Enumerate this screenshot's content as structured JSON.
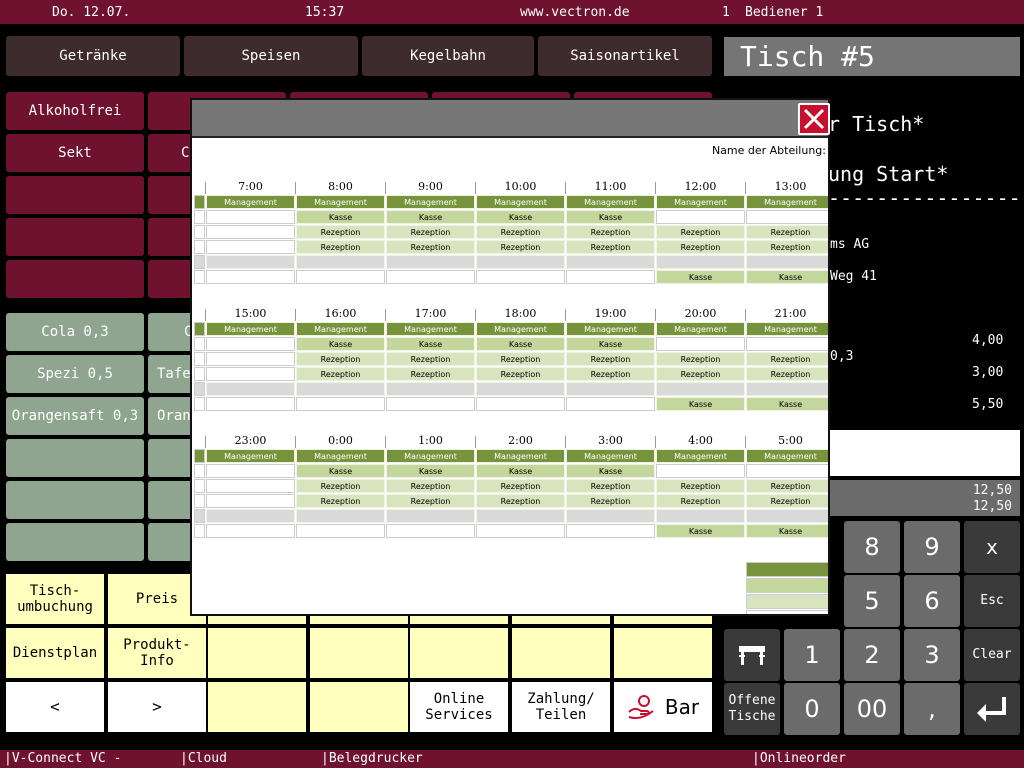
{
  "status_bar": {
    "date": "Do. 12.07.",
    "time": "15:37",
    "website": "www.vectron.de",
    "operator_no": "1",
    "operator_name": "Bediener 1"
  },
  "categories": [
    "Getränke",
    "Speisen",
    "Kegelbahn",
    "Saisonartikel"
  ],
  "subgroups": [
    "Alkoholfrei",
    "Sekt",
    "C"
  ],
  "products": [
    "Cola 0,3",
    "C",
    "Spezi 0,5",
    "Tafe",
    "Orangensaft 0,3",
    "Oran"
  ],
  "functions": {
    "tischumbuchung": "Tisch-\numbuchung",
    "preis": "Preis",
    "dienstplan": "Dienstplan",
    "produkt_info": "Produkt-\nInfo",
    "prev": "<",
    "next": ">",
    "online_services": "Online\nServices",
    "zahlung": "Zahlung/\nTeilen",
    "bar": "Bar"
  },
  "receipt": {
    "table_title": "Tisch #5",
    "line1": "r Tisch*",
    "line2": "ung Start*",
    "separator": "-------------------",
    "line3": "ms AG",
    "line4": "Weg 41",
    "amounts": [
      "4,00",
      "3,00",
      "5,50"
    ],
    "item_frag": "0,3",
    "total1": "12,50",
    "total2": "12,50"
  },
  "keypad": {
    "k8": "8",
    "k9": "9",
    "kx": "x",
    "k5": "5",
    "k6": "6",
    "esc": "Esc",
    "k1": "1",
    "k2": "2",
    "k3": "3",
    "clear": "Clear",
    "offene": "Offene\nTische",
    "k0": "0",
    "k00": "00",
    "comma": ","
  },
  "bottom_bar": {
    "vconnect": "|V-Connect  VC -",
    "cloud": "|Cloud",
    "printer": "|Belegdrucker",
    "onlineorder": "|Onlineorder"
  },
  "schedule": {
    "dept_label": "Name der Abteilung:",
    "blocks": [
      {
        "hours": [
          "7:00",
          "8:00",
          "9:00",
          "10:00",
          "11:00",
          "12:00",
          "13:00"
        ]
      },
      {
        "hours": [
          "15:00",
          "16:00",
          "17:00",
          "18:00",
          "19:00",
          "20:00",
          "21:00"
        ]
      },
      {
        "hours": [
          "23:00",
          "0:00",
          "1:00",
          "2:00",
          "3:00",
          "4:00",
          "5:00"
        ]
      }
    ],
    "roles": {
      "management": "Management",
      "kasse": "Kasse",
      "rezeption": "Rezeption"
    },
    "colors": {
      "management": "#77933c",
      "kasse": "#c3d69b",
      "rezeption": "#d7e4bd",
      "empty": "#d9d9d9"
    }
  },
  "colors": {
    "brand": "#6e1230",
    "category": "#3e2b2d",
    "product": "#8fa590",
    "function": "#ffffbe",
    "close": "#c8102e"
  }
}
